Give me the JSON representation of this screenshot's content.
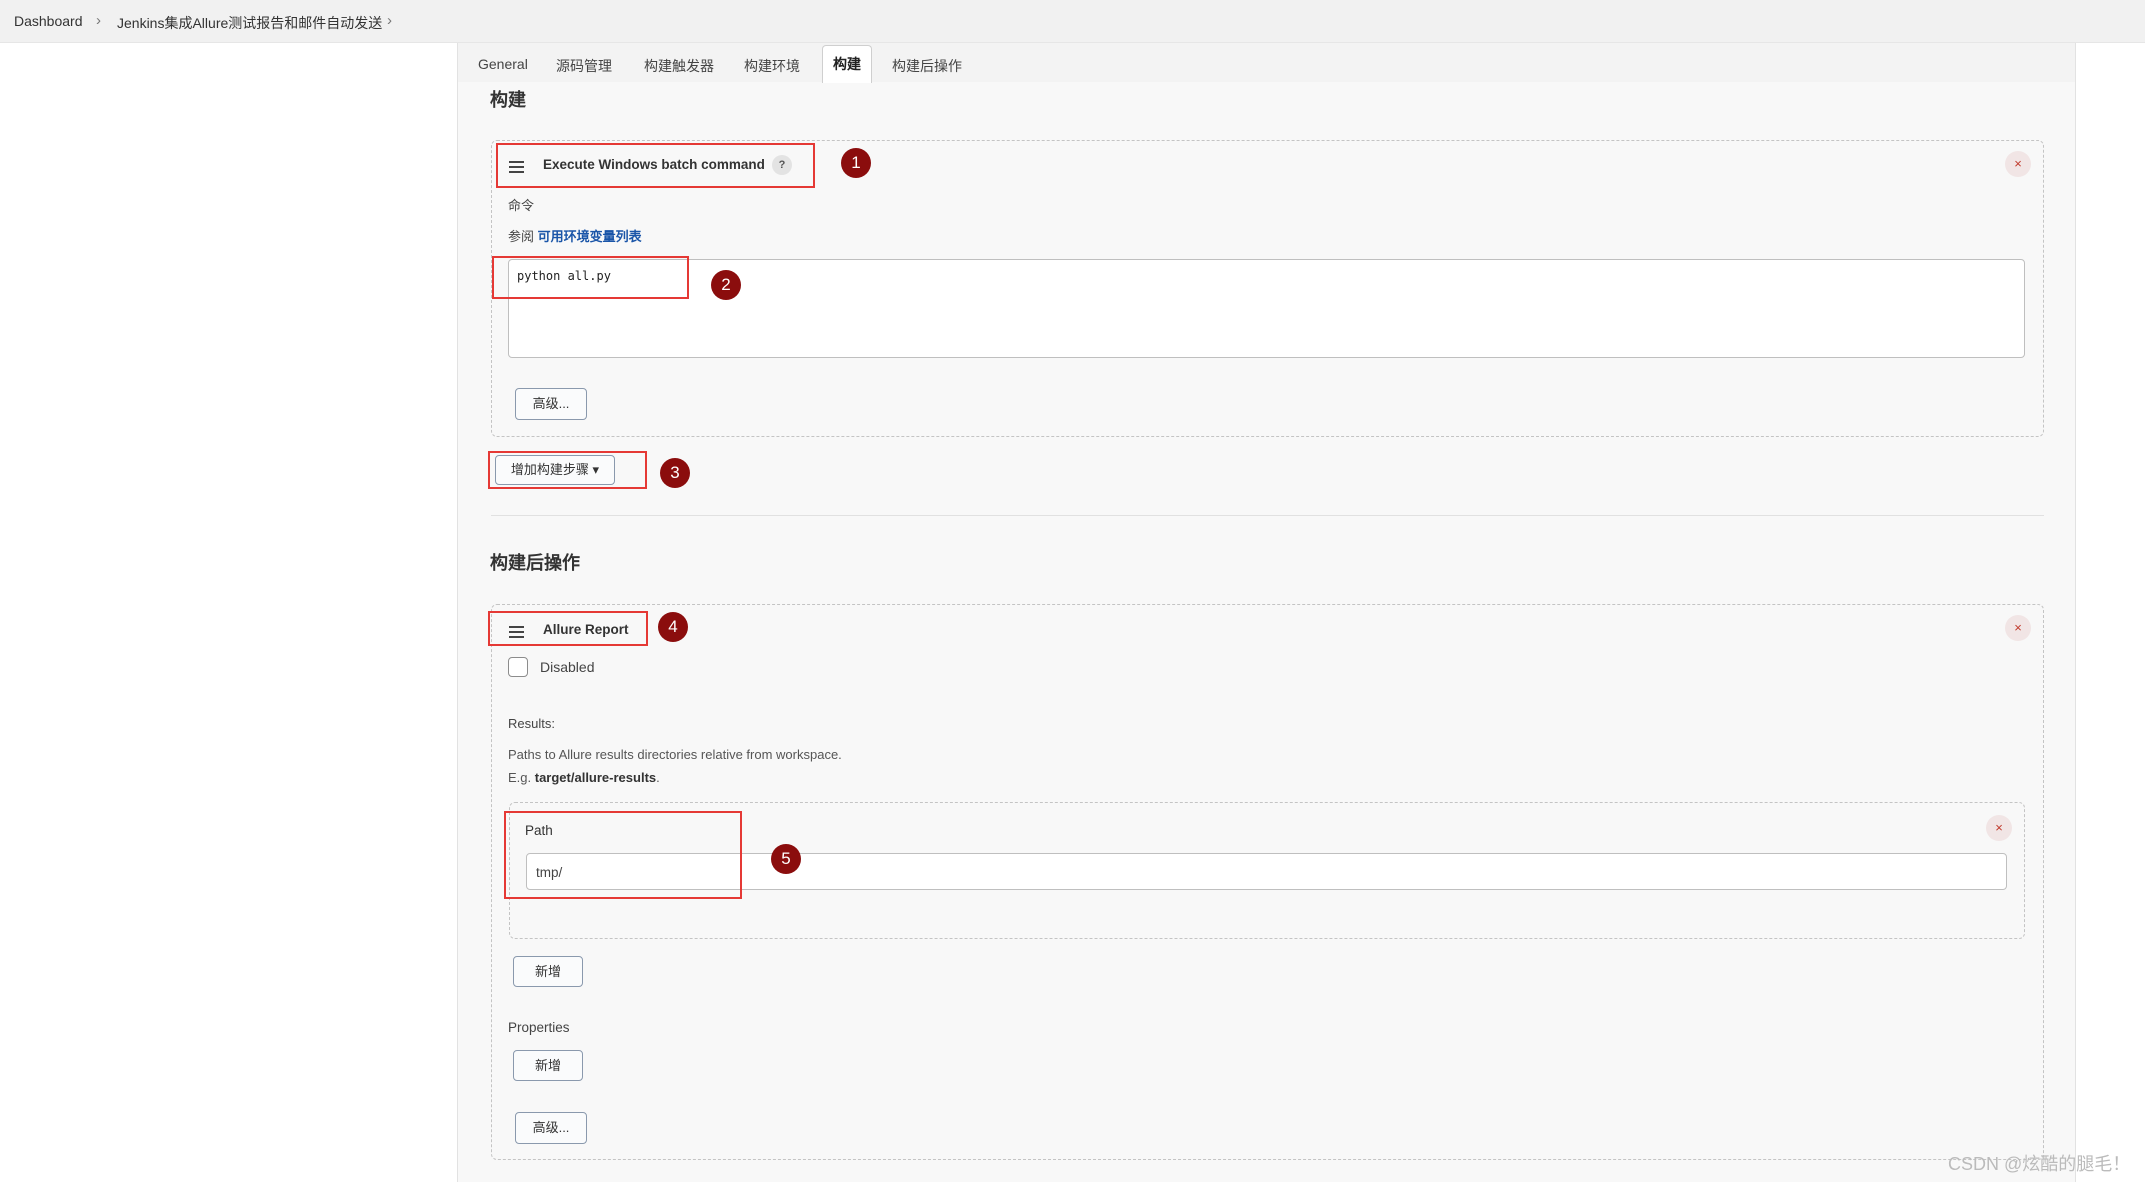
{
  "breadcrumb": {
    "items": [
      "Dashboard",
      "Jenkins集成Allure测试报告和邮件自动发送"
    ]
  },
  "tabs": [
    {
      "label": "General"
    },
    {
      "label": "源码管理"
    },
    {
      "label": "构建触发器"
    },
    {
      "label": "构建环境"
    },
    {
      "label": "构建",
      "active": true
    },
    {
      "label": "构建后操作"
    }
  ],
  "build": {
    "section_title": "构建",
    "step_title": "Execute Windows batch command",
    "help": "?",
    "command_label": "命令",
    "env_prefix": "参阅",
    "env_link": "可用环境变量列表",
    "command_value": "python all.py",
    "advanced_label": "高级...",
    "add_step_label": "增加构建步骤"
  },
  "post_build": {
    "section_title": "构建后操作",
    "step_title": "Allure Report",
    "disabled_label": "Disabled",
    "results_label": "Results:",
    "results_help": "Paths to Allure results directories relative from workspace.",
    "results_eg_prefix": "E.g. ",
    "results_eg_value": "target/allure-results",
    "results_eg_suffix": ".",
    "path_label": "Path",
    "path_value": "tmp/",
    "add_label": "新增",
    "properties_label": "Properties",
    "add_label_2": "新增",
    "advanced_label": "高级..."
  },
  "annotations": [
    "1",
    "2",
    "3",
    "4",
    "5"
  ],
  "icons": {
    "close": "×",
    "chevron": "›",
    "caret": "▾"
  },
  "colors": {
    "annotation_box": "#e53935",
    "badge": "#8b0d0d",
    "link": "#1a55a8"
  },
  "watermark": "CSDN @炫酷的腿毛！"
}
